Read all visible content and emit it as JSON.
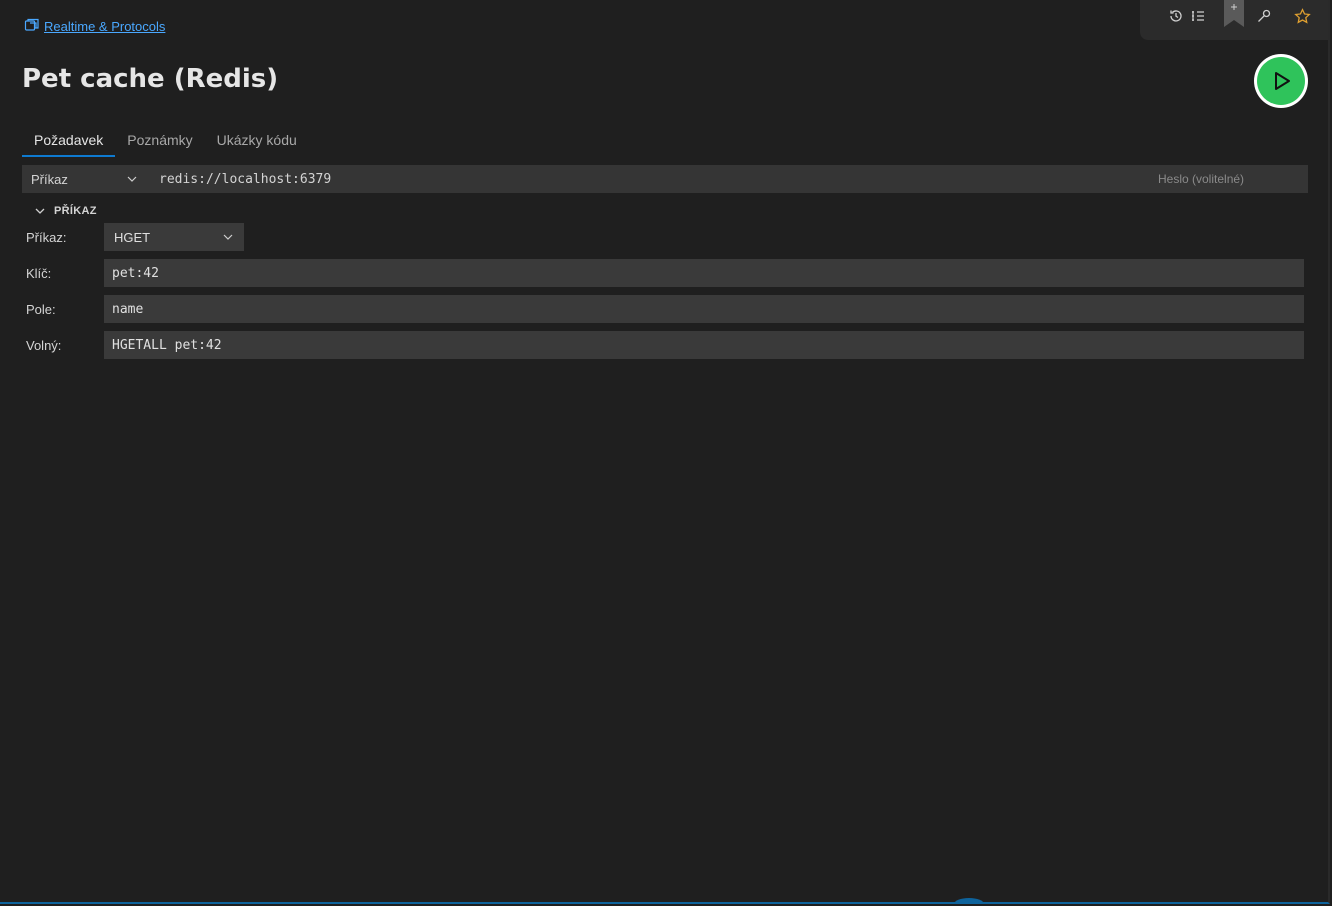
{
  "breadcrumb": {
    "icon": "folder-icon",
    "label": "Realtime & Protocols"
  },
  "page": {
    "title": "Pet cache (Redis)"
  },
  "toolbar": {
    "icons": [
      "history-icon",
      "list-icon",
      "bookmark-icon",
      "wrench-icon",
      "star-icon"
    ]
  },
  "tabs": [
    {
      "label": "Požadavek",
      "active": true
    },
    {
      "label": "Poznámky",
      "active": false
    },
    {
      "label": "Ukázky kódu",
      "active": false
    }
  ],
  "connection": {
    "mode": "Příkaz",
    "url": "redis://localhost:6379",
    "password_placeholder": "Heslo (volitelné)"
  },
  "section": {
    "title": "PŘÍKAZ"
  },
  "form": {
    "command_label": "Příkaz:",
    "command_value": "HGET",
    "key_label": "Klíč:",
    "key_value": "pet:42",
    "field_label": "Pole:",
    "field_value": "name",
    "raw_label": "Volný:",
    "raw_value": "HGETALL pet:42"
  },
  "colors": {
    "accent": "#0e7ad0",
    "link": "#4aa8ff",
    "run": "#2fc35b",
    "background": "#1f1f1f"
  }
}
